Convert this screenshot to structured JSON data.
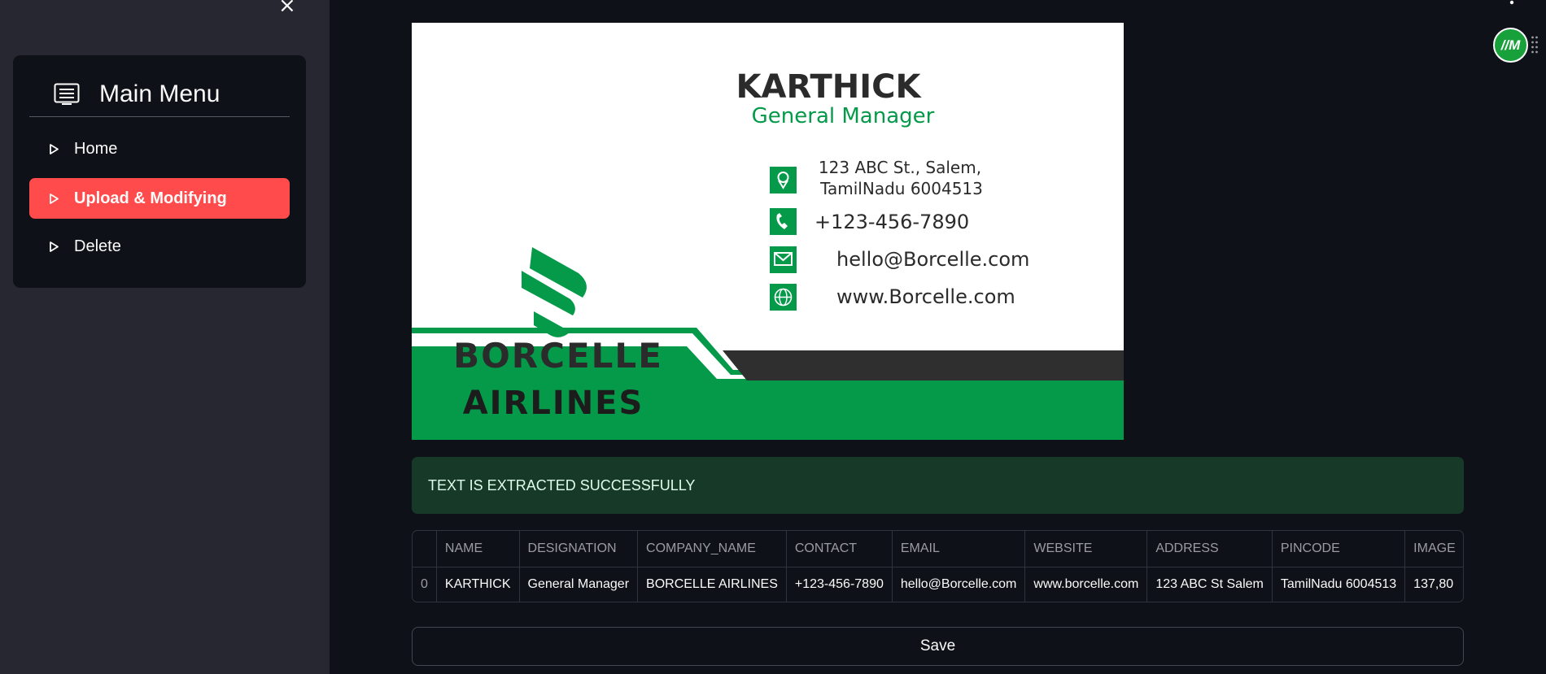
{
  "sidebar": {
    "close_glyph": "×",
    "menu": {
      "title": "Main Menu",
      "icon": "menu-list-icon",
      "items": [
        {
          "label": "Home",
          "icon": "caret-right-icon",
          "active": false
        },
        {
          "label": "Upload & Modifying",
          "icon": "caret-right-icon",
          "active": true
        },
        {
          "label": "Delete",
          "icon": "caret-right-icon",
          "active": false
        }
      ]
    }
  },
  "business_card": {
    "name": "KARTHICK",
    "designation": "General Manager",
    "address_line1": "123 ABC St., Salem,",
    "address_line2": "TamilNadu 6004513",
    "phone": "+123-456-7890",
    "email": "hello@Borcelle.com",
    "website": "www.Borcelle.com",
    "company_line1": "BORCELLE",
    "company_line2": "AIRLINES"
  },
  "status": {
    "message": "TEXT IS EXTRACTED SUCCESSFULLY"
  },
  "table": {
    "columns": [
      "",
      "NAME",
      "DESIGNATION",
      "COMPANY_NAME",
      "CONTACT",
      "EMAIL",
      "WEBSITE",
      "ADDRESS",
      "PINCODE",
      "IMAGE"
    ],
    "rows": [
      [
        "0",
        "KARTHICK",
        "General Manager",
        "BORCELLE AIRLINES",
        "+123-456-7890",
        "hello@Borcelle.com",
        "www.borcelle.com",
        "123 ABC St  Salem",
        "TamilNadu 6004513",
        "137,80"
      ]
    ]
  },
  "save_label": "Save",
  "avatar_text": "//M",
  "colors": {
    "accent": "#ff4b4b",
    "success_bg": "#173928",
    "brand_green": "#05994a",
    "bg": "#0e1117",
    "sidebar_bg": "#262730"
  }
}
